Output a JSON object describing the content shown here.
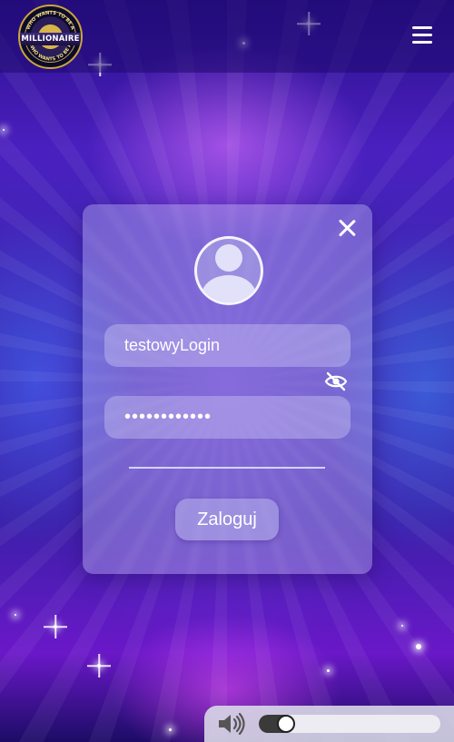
{
  "header": {
    "logo": {
      "name": "millionaire-logo",
      "lettering": [
        "WHO WANTS TO BE A",
        "MILLIONAIRE",
        "WHO WANTS TO BE A"
      ]
    },
    "menu_icon": "hamburger-menu-icon"
  },
  "login_form": {
    "close_icon": "close-icon",
    "avatar_icon": "user-avatar-icon",
    "login_value": "testowyLogin",
    "password_value": "••••••••••••",
    "password_visibility_icon": "eye-slash-icon",
    "submit_label": "Zaloguj"
  },
  "audio": {
    "speaker_icon": "speaker-volume-icon",
    "volume": 0.11
  },
  "colors": {
    "background_top": "#2a0f8a",
    "background_bottom": "#6a18c8",
    "card_tint": "#cdcdf5",
    "slider_fill": "#3a3a3a"
  }
}
